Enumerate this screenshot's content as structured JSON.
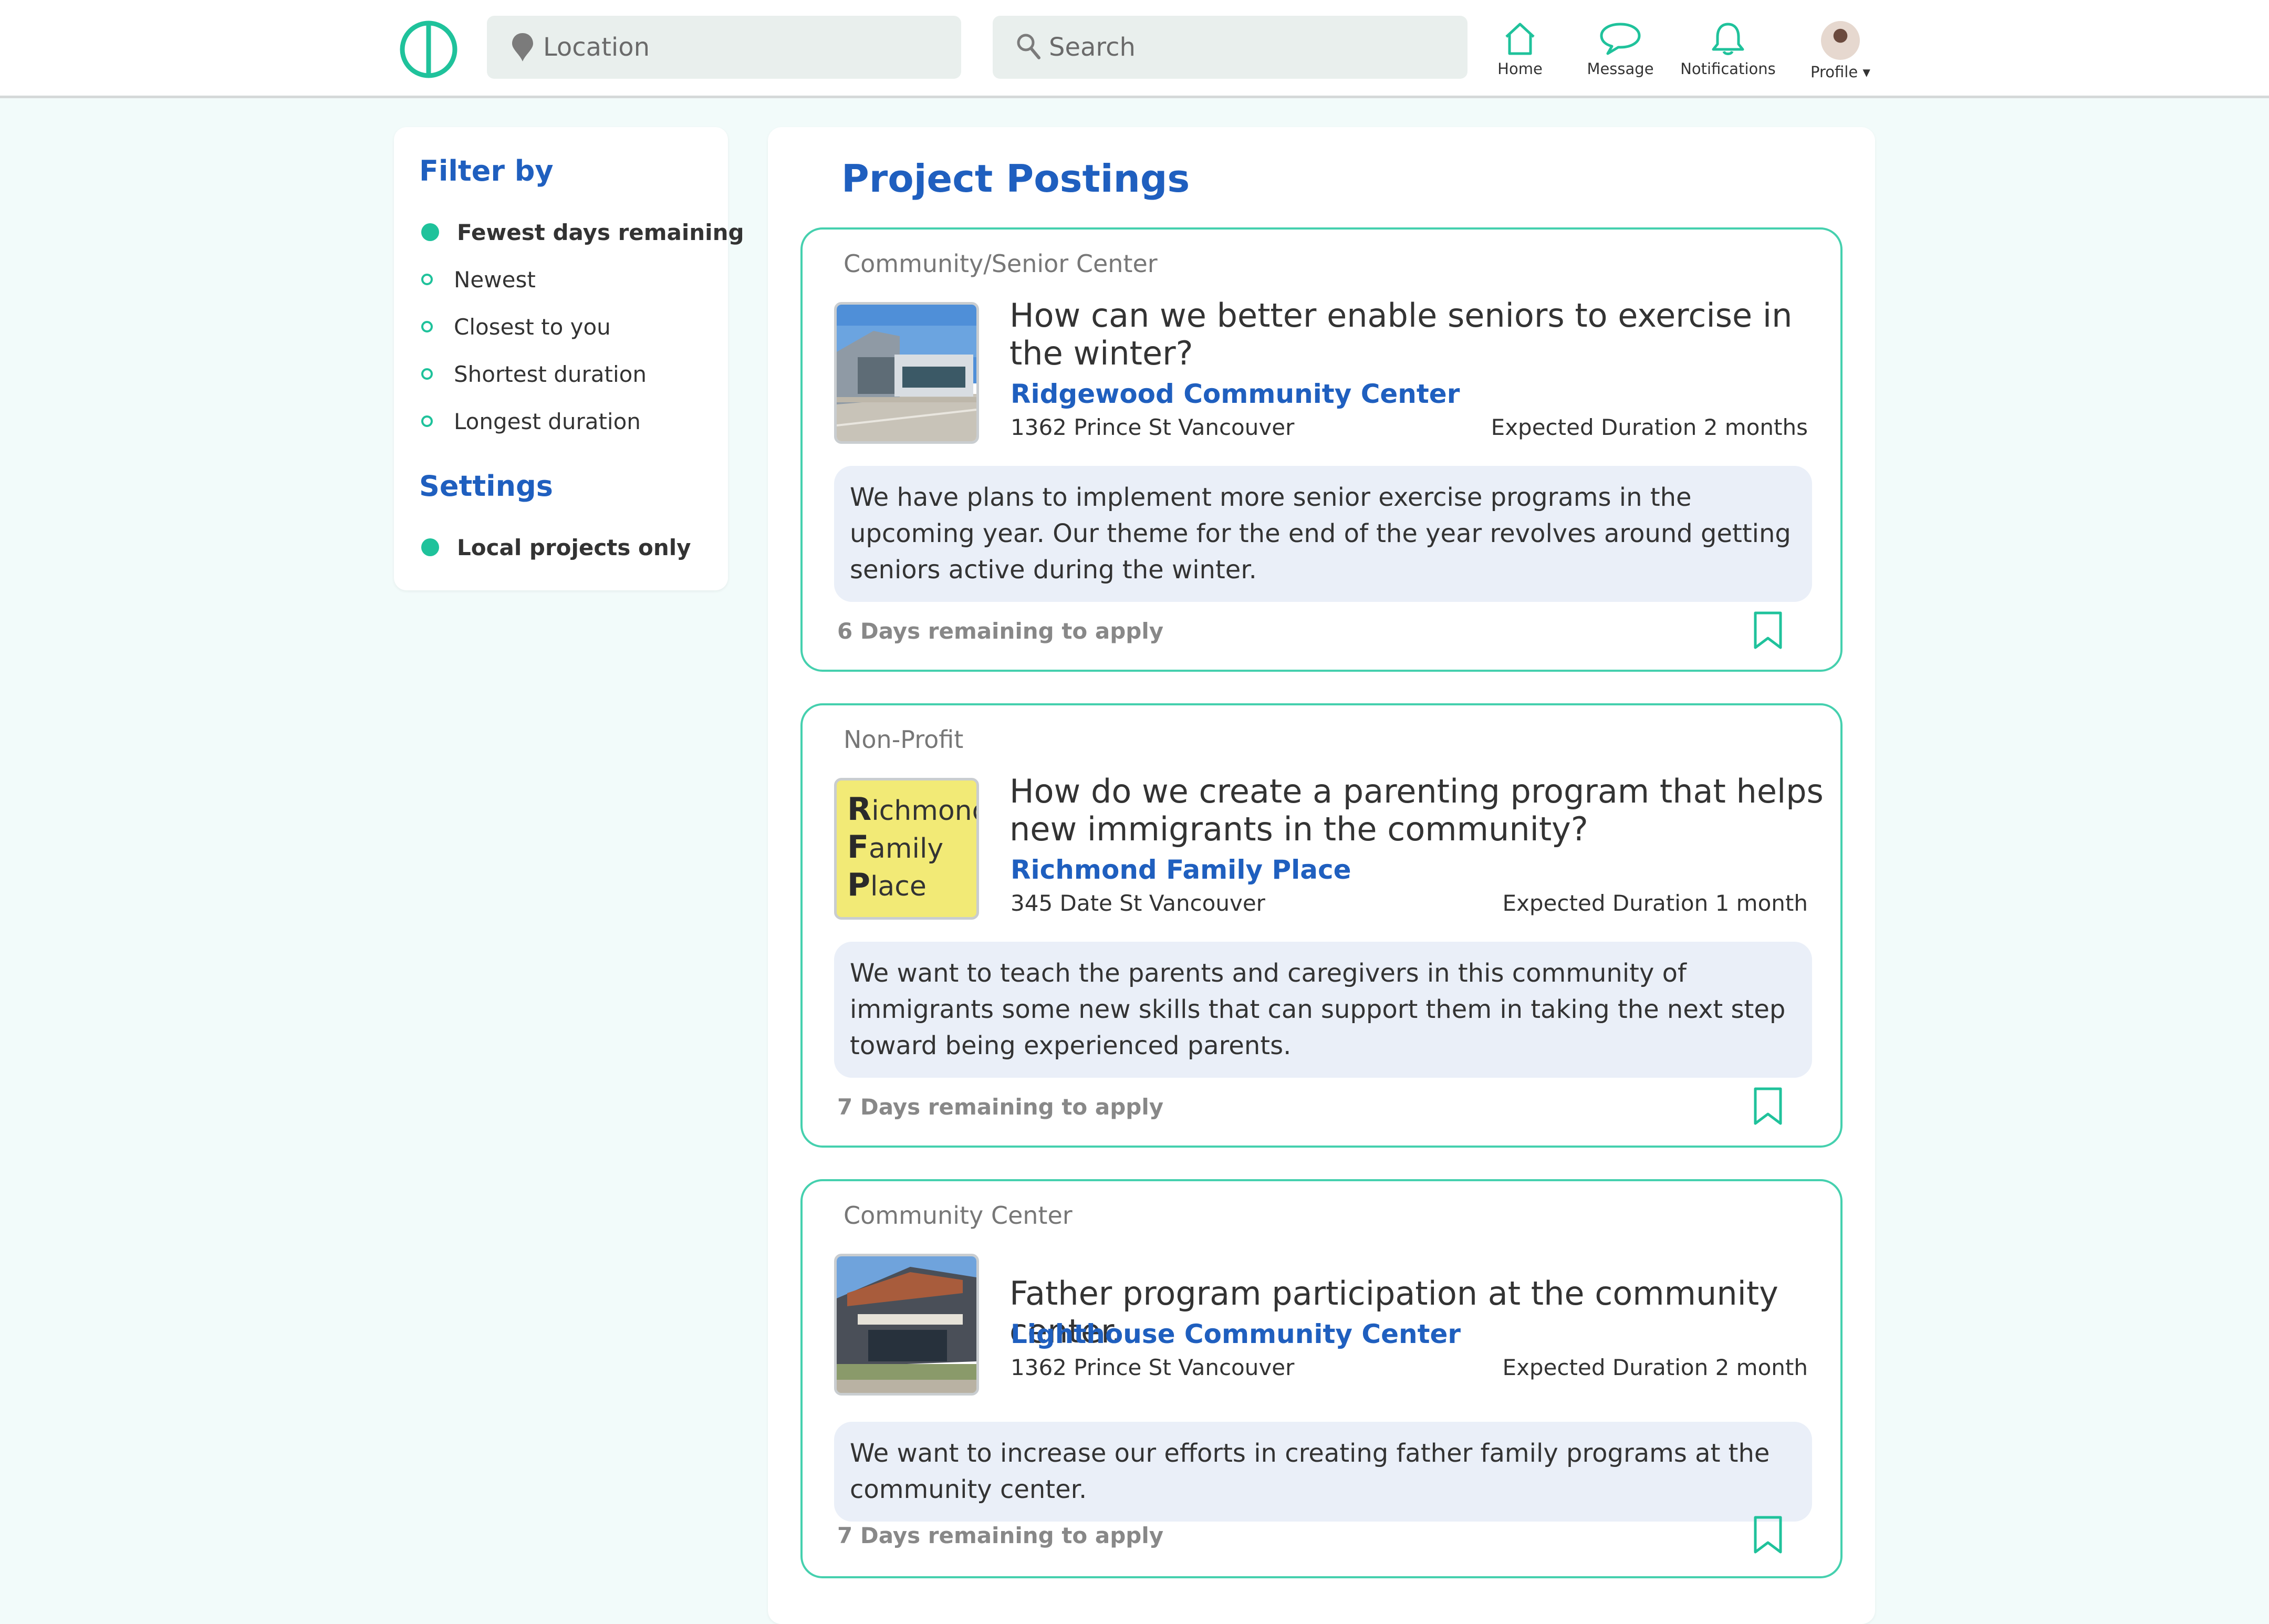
{
  "nav": {
    "logo": "cd-logo",
    "location_placeholder": "Location",
    "search_placeholder": "Search",
    "items": [
      {
        "label": "Home",
        "icon": "home-icon"
      },
      {
        "label": "Message",
        "icon": "message-icon"
      },
      {
        "label": "Notifications",
        "icon": "bell-icon"
      },
      {
        "label": "Profile ▾",
        "icon": "avatar"
      }
    ]
  },
  "sidebar": {
    "filter_title": "Filter by",
    "filters": [
      {
        "label": "Fewest days remaining",
        "selected": true
      },
      {
        "label": "Newest",
        "selected": false
      },
      {
        "label": "Closest to you",
        "selected": false
      },
      {
        "label": "Shortest duration",
        "selected": false
      },
      {
        "label": "Longest duration",
        "selected": false
      }
    ],
    "settings_title": "Settings",
    "settings": [
      {
        "label": "Local projects only",
        "selected": true
      }
    ]
  },
  "main": {
    "title": "Project Postings",
    "postings": [
      {
        "category": "Community/Senior Center",
        "question": "How can we better enable seniors to exercise in the winter?",
        "org": "Ridgewood Community Center",
        "address": "1362 Prince St Vancouver",
        "duration": "Expected Duration 2 months",
        "description": "We have plans to implement more senior exercise programs in the upcoming year. Our theme for the end of the year revolves around getting seniors active during the winter.",
        "remaining": "6 Days remaining to apply"
      },
      {
        "category": "Non-Profit",
        "question": "How do we create a parenting program that helps new immigrants in the community?",
        "org": "Richmond Family Place",
        "address": "345 Date St Vancouver",
        "duration": "Expected Duration 1 month",
        "description": "We want to teach the parents and caregivers in this community of immigrants some new skills that can support them in taking the next step toward being experienced parents.",
        "remaining": "7 Days remaining to apply",
        "logo_lines": [
          {
            "initial": "R",
            "rest": "ichmond"
          },
          {
            "initial": "F",
            "rest": "amily"
          },
          {
            "initial": "P",
            "rest": "lace"
          }
        ]
      },
      {
        "category": "Community Center",
        "question": "Father program participation at the community center.",
        "org": "Lighthouse Community Center",
        "address": "1362 Prince St Vancouver",
        "duration": "Expected Duration 2 month",
        "description": "We want to increase our efforts in creating father family programs at the community center.",
        "remaining": "7 Days remaining to apply"
      }
    ]
  },
  "colors": {
    "accent_green": "#1fc29b",
    "brand_blue": "#1f5fbf",
    "page_bg": "#f2fbfa",
    "desc_bg": "#eaeff8"
  }
}
